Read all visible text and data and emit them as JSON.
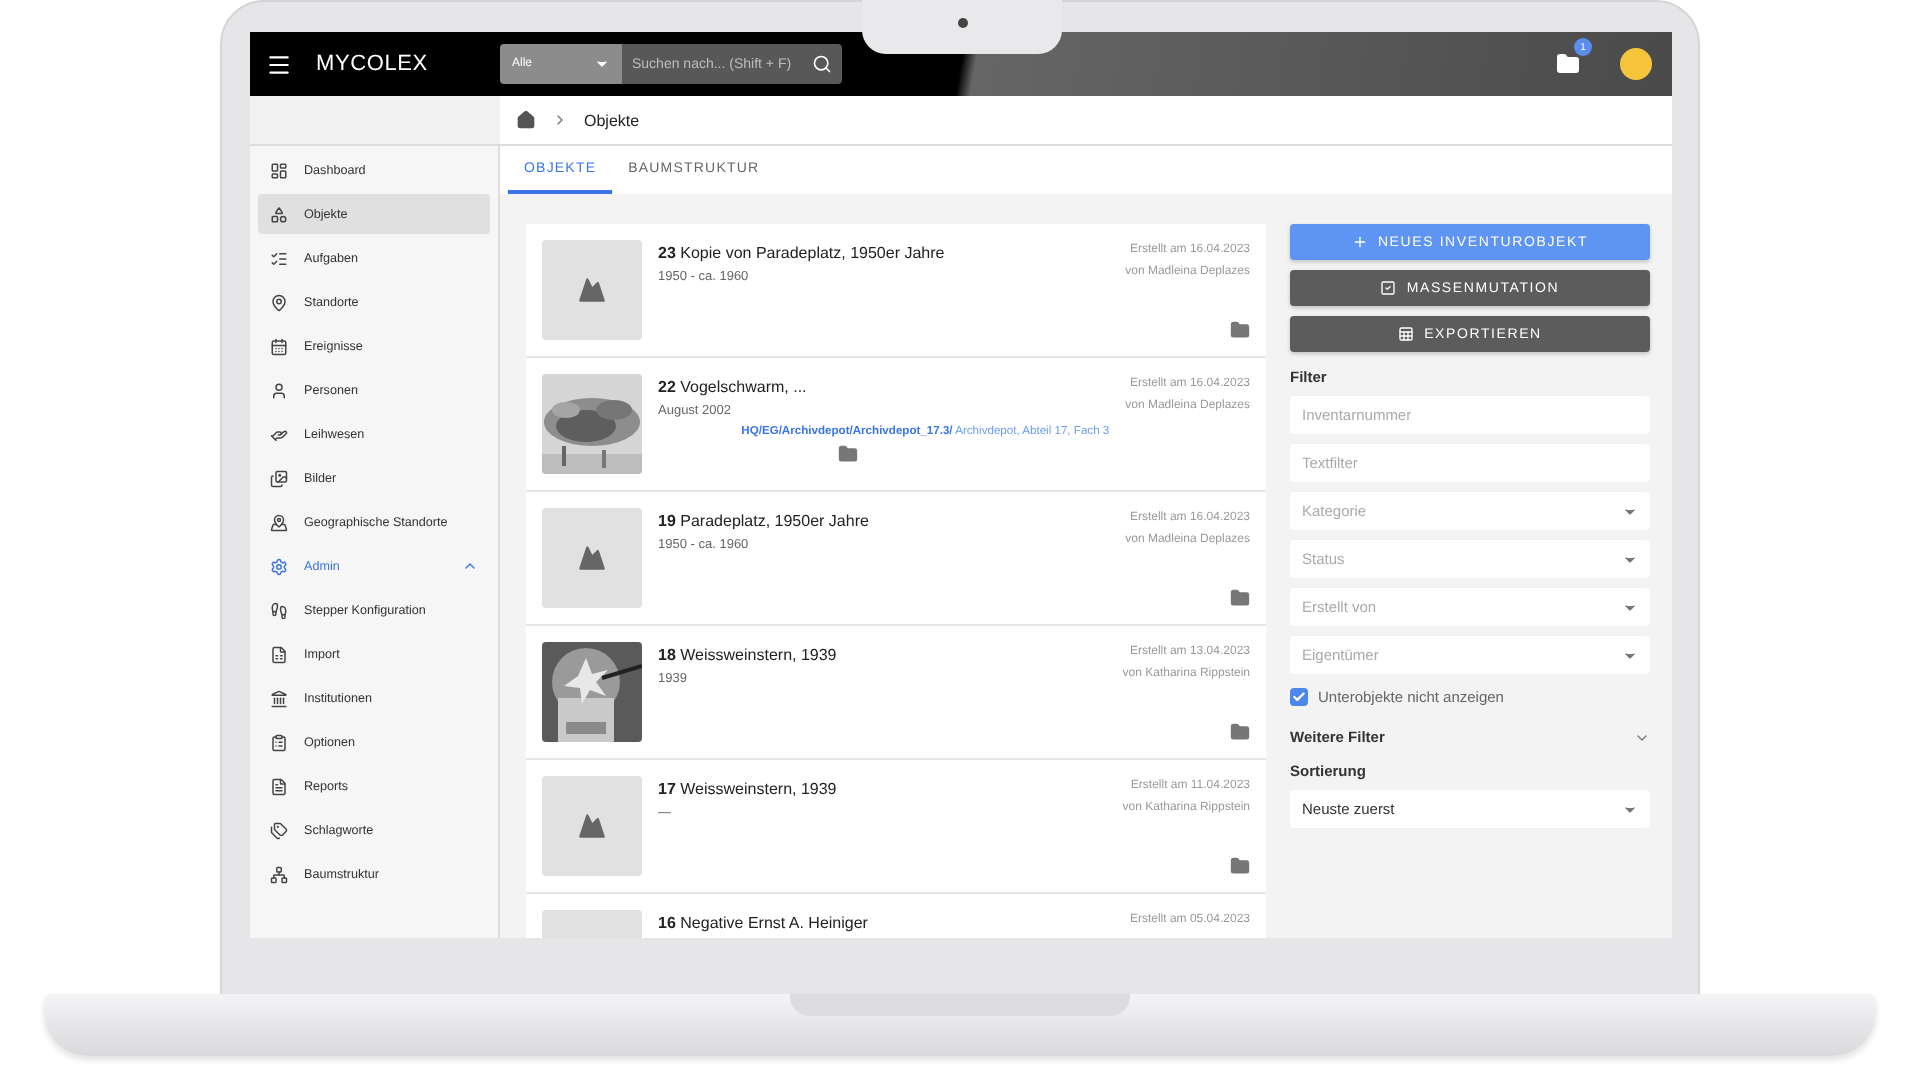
{
  "app": {
    "title": "MYCOLEX"
  },
  "search": {
    "scope": "Alle",
    "placeholder": "Suchen nach... (Shift + F)"
  },
  "notifications": {
    "badge": "1"
  },
  "breadcrumb": [
    "Objekte"
  ],
  "sidebar": {
    "items": [
      {
        "label": "Dashboard",
        "selected": false
      },
      {
        "label": "Objekte",
        "selected": true
      },
      {
        "label": "Aufgaben",
        "selected": false
      },
      {
        "label": "Standorte",
        "selected": false
      },
      {
        "label": "Ereignisse",
        "selected": false
      },
      {
        "label": "Personen",
        "selected": false
      },
      {
        "label": "Leihwesen",
        "selected": false
      },
      {
        "label": "Bilder",
        "selected": false
      },
      {
        "label": "Geographische Standorte",
        "selected": false
      },
      {
        "label": "Admin",
        "selected": false,
        "kind": "group",
        "expanded": true
      },
      {
        "label": "Stepper Konfiguration",
        "selected": false
      },
      {
        "label": "Import",
        "selected": false
      },
      {
        "label": "Institutionen",
        "selected": false
      },
      {
        "label": "Optionen",
        "selected": false
      },
      {
        "label": "Reports",
        "selected": false
      },
      {
        "label": "Schlagworte",
        "selected": false
      },
      {
        "label": "Baumstruktur",
        "selected": false
      }
    ]
  },
  "tabs": [
    {
      "label": "OBJEKTE",
      "selected": true
    },
    {
      "label": "BAUMSTRUKTUR",
      "selected": false
    }
  ],
  "objects": [
    {
      "number": "23",
      "title": "Kopie von Paradeplatz, 1950er Jahre",
      "date": "1950 - ca. 1960",
      "created": "Erstellt am 16.04.2023",
      "author": "von Madleina Deplazes",
      "thumbnail": {
        "kind": "placeholder"
      }
    },
    {
      "number": "22",
      "title": "Vogelschwarm, ...",
      "date": "August 2002",
      "created": "Erstellt am 16.04.2023",
      "author": "von Madleina Deplazes",
      "location": {
        "path": "HQ/EG/Archivdepot/Archivdepot_17.3/",
        "detail": "Archivdepot, Abteil 17, Fach 3"
      }
    },
    {
      "number": "19",
      "title": "Paradeplatz, 1950er Jahre",
      "date": "1950 - ca. 1960",
      "created": "Erstellt am 16.04.2023",
      "author": "von Madleina Deplazes",
      "thumbnail": {
        "kind": "placeholder"
      }
    },
    {
      "number": "18",
      "title": "Weissweinstern, 1939",
      "date": "1939",
      "created": "Erstellt am 13.04.2023",
      "author": "von Katharina Rippstein"
    },
    {
      "number": "17",
      "title": "Weissweinstern, 1939",
      "date": "—",
      "created": "Erstellt am 11.04.2023",
      "author": "von Katharina Rippstein",
      "thumbnail": {
        "kind": "placeholder"
      }
    },
    {
      "number": "16",
      "title": "Negative Ernst A. Heiniger",
      "created": "Erstellt am 05.04.2023",
      "thumbnail": {
        "kind": "blank"
      }
    }
  ],
  "actions": [
    {
      "label": "NEUES INVENTUROBJEKT",
      "kind": "primary"
    },
    {
      "label": "MASSENMUTATION",
      "kind": "secondary"
    },
    {
      "label": "EXPORTIEREN",
      "kind": "secondary"
    }
  ],
  "filter": {
    "title": "Filter",
    "fields": [
      {
        "placeholder": "Inventarnummer",
        "kind": "text"
      },
      {
        "placeholder": "Textfilter",
        "kind": "text"
      },
      {
        "placeholder": "Kategorie",
        "kind": "select"
      },
      {
        "placeholder": "Status",
        "kind": "select"
      },
      {
        "placeholder": "Erstellt von",
        "kind": "select"
      },
      {
        "placeholder": "Eigentümer",
        "kind": "select"
      }
    ],
    "checkbox": {
      "label": "Unterobjekte nicht anzeigen",
      "checked": true
    },
    "more": {
      "label": "Weitere Filter",
      "expanded": false
    }
  },
  "sorting": {
    "title": "Sortierung",
    "value": "Neuste zuerst"
  }
}
